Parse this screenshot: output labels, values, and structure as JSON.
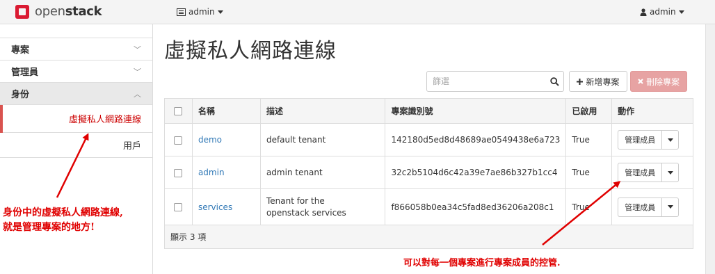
{
  "topbar": {
    "brand_prefix": "open",
    "brand_suffix": "stack",
    "project_switcher": "admin",
    "user_menu": "admin"
  },
  "sidebar": {
    "sections": [
      {
        "label": "專案",
        "chevron": "﹀"
      },
      {
        "label": "管理員",
        "chevron": "﹀"
      },
      {
        "label": "身份",
        "chevron": "︿"
      }
    ],
    "items": [
      {
        "label": "虛擬私人網路連線"
      },
      {
        "label": "用戶"
      }
    ]
  },
  "main": {
    "title": "虛擬私人網路連線",
    "filter_placeholder": "篩選",
    "create_button": "新增專案",
    "delete_button": "刪除專案"
  },
  "table": {
    "headers": [
      "名稱",
      "描述",
      "專案識別號",
      "已啟用",
      "動作"
    ],
    "rows": [
      {
        "name": "demo",
        "description": "default tenant",
        "id": "142180d5ed8d48689ae0549438e6a723",
        "enabled": "True",
        "action": "管理成員"
      },
      {
        "name": "admin",
        "description": "admin tenant",
        "id": "32c2b5104d6c42a39e7ae86b327b1cc4",
        "enabled": "True",
        "action": "管理成員"
      },
      {
        "name": "services",
        "description_line1": "Tenant for the",
        "description_line2": "openstack services",
        "id": "f866058b0ea34c5fad8ed36206a208c1",
        "enabled": "True",
        "action": "管理成員"
      }
    ],
    "footer": "顯示 3 項"
  },
  "annotations": {
    "left_line1": "身份中的虛擬私人網路連線,",
    "left_line2": "就是管理專案的地方!",
    "right": "可以對每一個專案進行專案成員的控管."
  },
  "colors": {
    "brand": "#da1a32",
    "annotation": "#e00000",
    "link": "#337ab7",
    "delete_button": "#e7a3a3"
  }
}
